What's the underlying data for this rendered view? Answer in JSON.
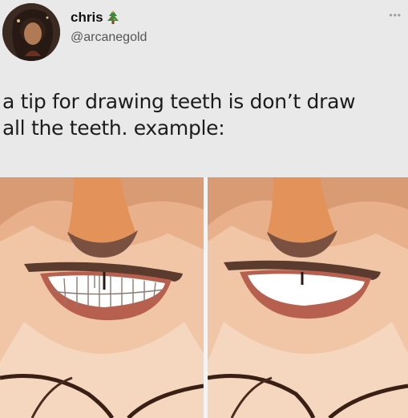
{
  "user": {
    "name": "chris",
    "name_emoji_icon": "christmas-tree-icon",
    "handle": "@arcanegold"
  },
  "tweet": {
    "text_line1": "a tip for drawing teeth is don’t draw",
    "text_line2": "all the teeth. example:"
  },
  "media": {
    "left_panel": "teeth-drawn-individually",
    "right_panel": "teeth-simplified"
  },
  "colors": {
    "background": "#e9e9e9",
    "skin": "#e7b08c",
    "skin_light": "#f2c7a8",
    "nose": "#e1965a",
    "lips": "#5a3b2e"
  }
}
